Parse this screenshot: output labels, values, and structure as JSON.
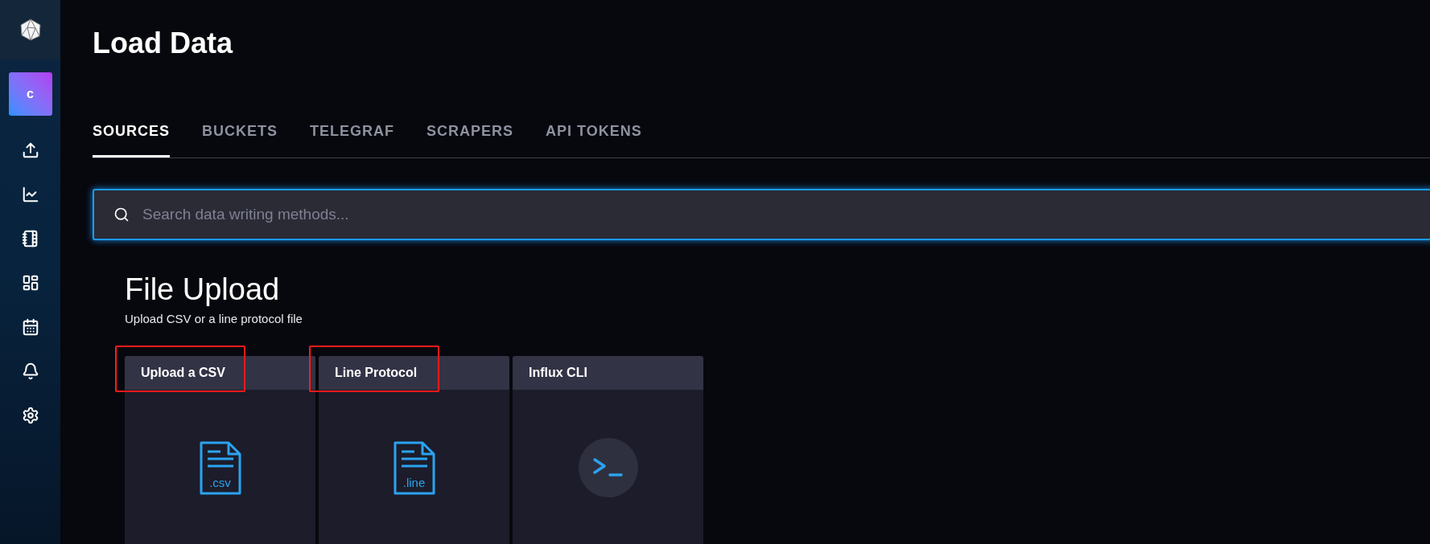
{
  "sidebar": {
    "org_initial": "c",
    "items": [
      {
        "kind": "upload"
      },
      {
        "kind": "chart"
      },
      {
        "kind": "notebook"
      },
      {
        "kind": "dashboard"
      },
      {
        "kind": "calendar"
      },
      {
        "kind": "bell"
      },
      {
        "kind": "settings"
      }
    ]
  },
  "page": {
    "title": "Load Data"
  },
  "tabs": [
    {
      "label": "SOURCES",
      "selected": true
    },
    {
      "label": "BUCKETS",
      "selected": false
    },
    {
      "label": "TELEGRAF",
      "selected": false
    },
    {
      "label": "SCRAPERS",
      "selected": false
    },
    {
      "label": "API TOKENS",
      "selected": false
    }
  ],
  "search": {
    "placeholder": "Search data writing methods..."
  },
  "section": {
    "title": "File Upload",
    "subtitle": "Upload CSV or a line protocol file"
  },
  "cards": [
    {
      "title": "Upload a CSV",
      "kind": "file",
      "file_ext": ".csv",
      "highlighted": true
    },
    {
      "title": "Line Protocol",
      "kind": "file",
      "file_ext": ".line",
      "highlighted": true
    },
    {
      "title": "Influx CLI",
      "kind": "terminal",
      "highlighted": false
    }
  ]
}
